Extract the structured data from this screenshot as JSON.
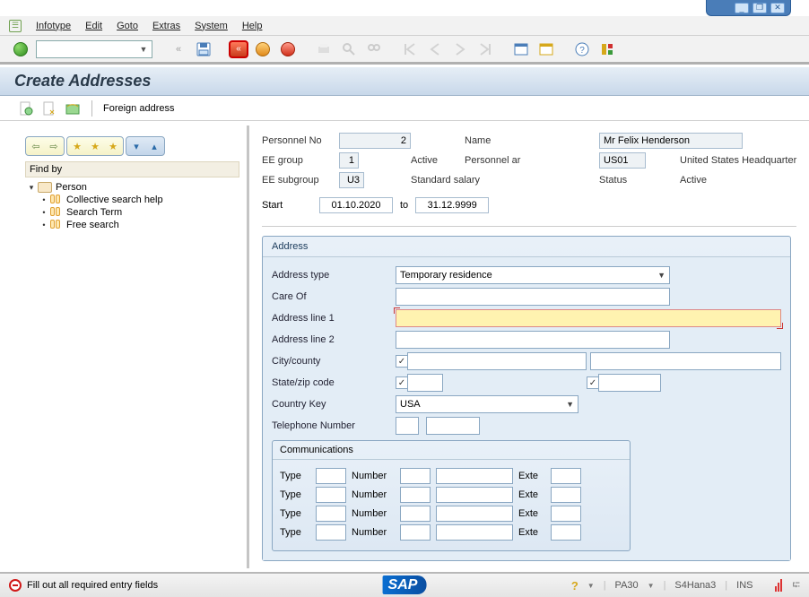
{
  "window_controls": {
    "minimize": "_",
    "maximize": "❐",
    "close": "✕"
  },
  "menubar": {
    "items": [
      "Infotype",
      "Edit",
      "Goto",
      "Extras",
      "System",
      "Help"
    ]
  },
  "page_title": "Create Addresses",
  "subtoolbar": {
    "foreign_address": "Foreign address"
  },
  "left": {
    "findby": "Find by",
    "tree": {
      "root": "Person",
      "children": [
        "Collective search help",
        "Search Term",
        "Free search"
      ]
    }
  },
  "header": {
    "personnel_no_lbl": "Personnel No",
    "personnel_no": "2",
    "name_lbl": "Name",
    "name_value": "Mr Felix Henderson",
    "ee_group_lbl": "EE group",
    "ee_group_code": "1",
    "ee_group_text": "Active",
    "pers_area_lbl": "Personnel ar",
    "pers_area_code": "US01",
    "pers_area_text": "United States Headquarter",
    "ee_subgroup_lbl": "EE subgroup",
    "ee_subgroup_code": "U3",
    "ee_subgroup_text": "Standard salary",
    "status_lbl": "Status",
    "status_value": "Active",
    "start_lbl": "Start",
    "start_value": "01.10.2020",
    "to_lbl": "to",
    "end_value": "31.12.9999"
  },
  "address": {
    "panel_title": "Address",
    "type_lbl": "Address type",
    "type_value": "Temporary residence",
    "careof_lbl": "Care Of",
    "careof_value": "",
    "line1_lbl": "Address line 1",
    "line1_value": "",
    "line2_lbl": "Address line 2",
    "line2_value": "",
    "city_lbl": "City/county",
    "city_value": "",
    "county_value": "",
    "state_lbl": "State/zip code",
    "state_value": "",
    "zip_value": "",
    "country_lbl": "Country Key",
    "country_value": "USA",
    "phone_lbl": "Telephone Number",
    "phone_a": "",
    "phone_b": ""
  },
  "communications": {
    "title": "Communications",
    "type_lbl": "Type",
    "number_lbl": "Number",
    "ext_lbl": "Exte",
    "rows": [
      {
        "type": "",
        "num_a": "",
        "num_b": "",
        "ext": ""
      },
      {
        "type": "",
        "num_a": "",
        "num_b": "",
        "ext": ""
      },
      {
        "type": "",
        "num_a": "",
        "num_b": "",
        "ext": ""
      },
      {
        "type": "",
        "num_a": "",
        "num_b": "",
        "ext": ""
      }
    ]
  },
  "statusbar": {
    "message": "Fill out all required entry fields",
    "sap": "SAP",
    "right": {
      "tcode": "PA30",
      "system": "S4Hana3",
      "mode": "INS"
    }
  }
}
